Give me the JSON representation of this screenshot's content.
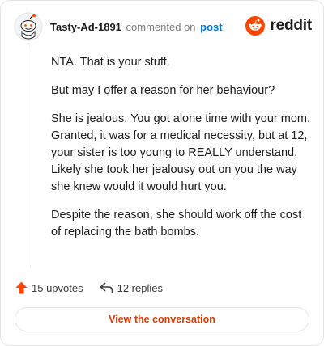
{
  "header": {
    "username": "Tasty-Ad-1891",
    "verb": "commented on",
    "post_link": "post",
    "brand": "reddit"
  },
  "comment": {
    "paragraphs": [
      "NTA. That is your stuff.",
      "But may I offer a reason for her behaviour?",
      "She is jealous. You got alone time with your mom. Granted, it was for a medical necessity, but at 12, your sister is too young to REALLY understand. Likely she took her jealousy out on you the way she knew would it would hurt you.",
      "Despite the reason, she should work off the cost of replacing the bath bombs."
    ]
  },
  "footer": {
    "upvotes": "15 upvotes",
    "replies": "12 replies",
    "cta": "View the conversation"
  },
  "icons": {
    "upvote": "upvote-arrow-icon",
    "reply": "reply-arrow-icon",
    "logo": "reddit-snoo-icon"
  },
  "colors": {
    "brand_orange": "#ff4500",
    "link_blue": "#0079d3",
    "cta_text": "#d93a00"
  }
}
